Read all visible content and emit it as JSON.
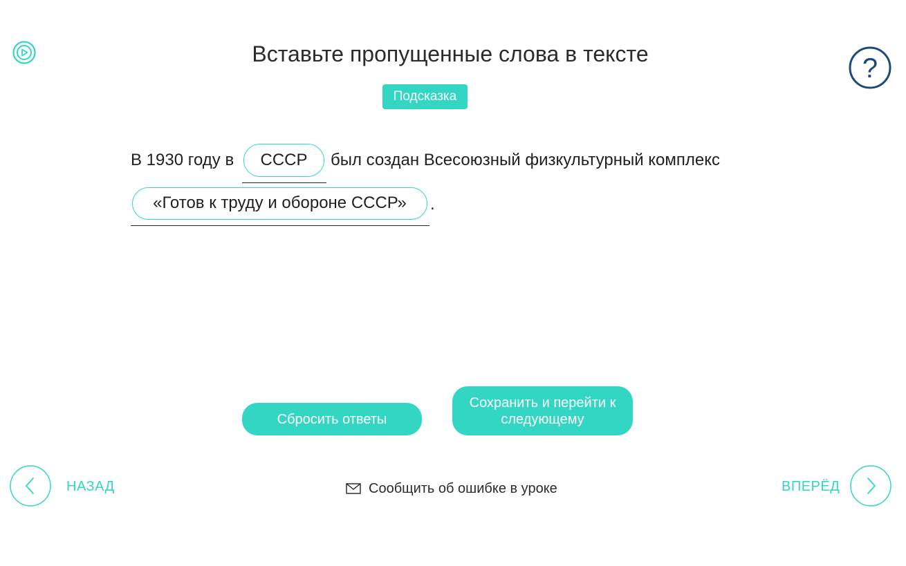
{
  "header": {
    "title": "Вставьте пропущенные слова в тексте",
    "hint_label": "Подсказка"
  },
  "exercise": {
    "text_part_1": "В 1930 году в",
    "answer_1": "СССР",
    "text_part_2": "был создан Всесоюзный физкультурный комплекс",
    "answer_2": "«Готов к труду и обороне СССР»",
    "text_part_3": "."
  },
  "actions": {
    "reset_label": "Сбросить ответы",
    "save_line_1": "Сохранить и перейти к",
    "save_line_2": "следующему"
  },
  "footer": {
    "back_label": "НАЗАД",
    "forward_label": "ВПЕРЁД",
    "report_label": "Сообщить об ошибке в уроке"
  },
  "icons": {
    "video": "video-play-icon",
    "help": "question-mark-icon",
    "back": "chevron-left-icon",
    "forward": "chevron-right-icon",
    "mail": "envelope-icon"
  },
  "colors": {
    "accent": "#33d6c3",
    "help_icon": "#1c4a7a",
    "text": "#1f1f1f"
  }
}
